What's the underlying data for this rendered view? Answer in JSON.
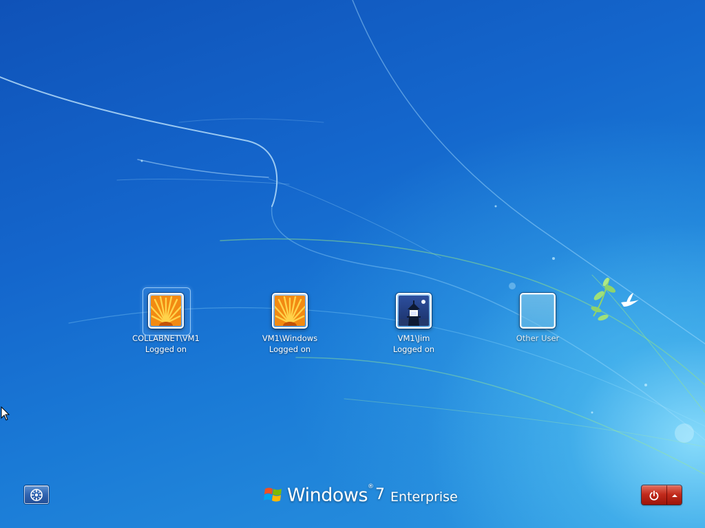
{
  "users": [
    {
      "name": "COLLABNET\\VM1",
      "status": "Logged on",
      "picture": "flower-orange",
      "selected": true
    },
    {
      "name": "VM1\\Windows",
      "status": "Logged on",
      "picture": "flower-orange",
      "selected": false
    },
    {
      "name": "VM1\\Jim",
      "status": "Logged on",
      "picture": "lighthouse",
      "selected": false
    },
    {
      "name": "Other User",
      "status": "",
      "picture": "blank",
      "selected": false
    }
  ],
  "branding": {
    "product_word": "Windows",
    "version": "7",
    "edition": "Enterprise"
  },
  "buttons": {
    "ease_of_access": "ease-of-access-icon",
    "shutdown": "power-icon",
    "shutdown_options": "chevron-up-icon"
  },
  "colors": {
    "accent_blue": "#1466cc",
    "power_red": "#c12a1b"
  }
}
